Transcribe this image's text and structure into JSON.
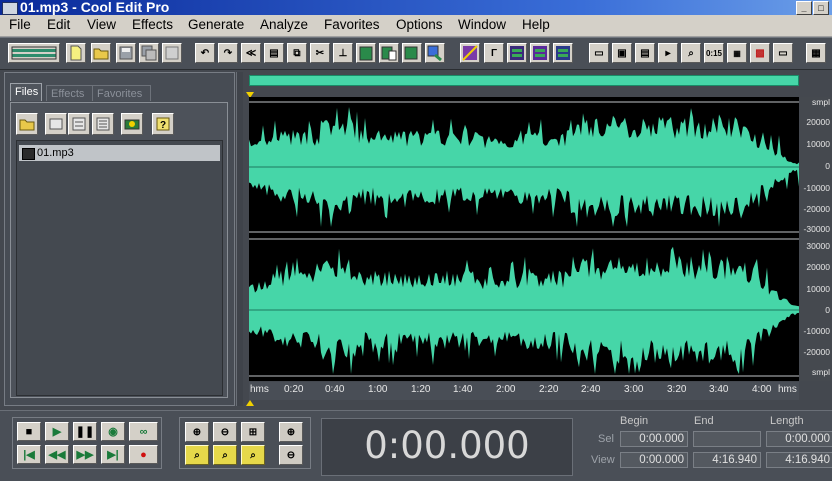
{
  "window": {
    "title": "01.mp3 - Cool Edit Pro",
    "controls": [
      "_",
      "□"
    ]
  },
  "menu": [
    "File",
    "Edit",
    "View",
    "Effects",
    "Generate",
    "Analyze",
    "Favorites",
    "Options",
    "Window",
    "Help"
  ],
  "left_panel": {
    "tabs": [
      "Files",
      "Effects",
      "Favorites"
    ],
    "active_tab": "Files",
    "tool_buttons": [
      "open-file-icon",
      "close-file-icon",
      "insert-icon",
      "edit-file-icon",
      "properties-icon",
      "help-icon"
    ],
    "files": [
      "01.mp3"
    ]
  },
  "waveform": {
    "colors": {
      "wave": "#46d6a8",
      "background": "#000000",
      "center_line": "#1f7a60"
    },
    "channels": 2,
    "amplitude_label": "smpl",
    "channel1_scale": [
      "smpl",
      "20000",
      "10000",
      "0",
      "-10000",
      "-20000",
      "-30000"
    ],
    "channel2_scale": [
      "30000",
      "20000",
      "10000",
      "0",
      "-10000",
      "-20000",
      "smpl"
    ]
  },
  "ruler": {
    "unit": "hms",
    "ticks": [
      "0:20",
      "0:40",
      "1:00",
      "1:20",
      "1:40",
      "2:00",
      "2:20",
      "2:40",
      "3:00",
      "3:20",
      "3:40",
      "4:00"
    ],
    "end_label": "hms"
  },
  "transport": {
    "buttons": [
      "stop",
      "play",
      "pause",
      "play-to-end",
      "loop",
      "go-to-start",
      "rewind",
      "fast-forward",
      "go-to-end",
      "record"
    ]
  },
  "zoom": {
    "buttons": [
      "zoom-in-horizontal",
      "zoom-out-horizontal",
      "zoom-full",
      "zoom-in-vertical",
      "zoom-to-selection",
      "zoom-left",
      "zoom-right",
      "zoom-out-vertical"
    ]
  },
  "time_display": {
    "value": "0:00.000"
  },
  "selection": {
    "headers": {
      "begin": "Begin",
      "end": "End",
      "length": "Length"
    },
    "sel": {
      "label": "Sel",
      "begin": "0:00.000",
      "end": "",
      "length": "0:00.000"
    },
    "view": {
      "label": "View",
      "begin": "0:00.000",
      "end": "4:16.940",
      "length": "4:16.940"
    }
  }
}
